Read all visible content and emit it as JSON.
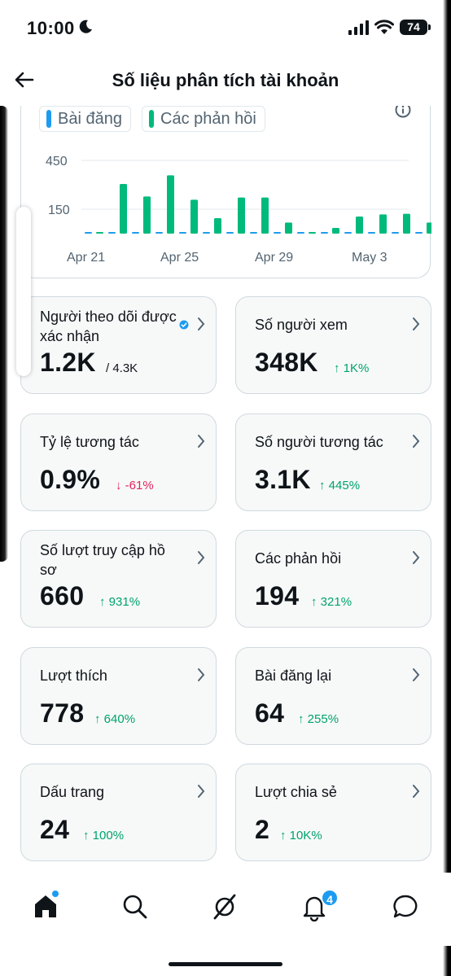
{
  "status_bar": {
    "time": "10:00",
    "battery": "74"
  },
  "header": {
    "title": "Số liệu phân tích tài khoản"
  },
  "chart": {
    "legend": [
      {
        "label": "Bài đăng",
        "color": "#1d9bf0"
      },
      {
        "label": "Các phản hồi",
        "color": "#00ba7c"
      }
    ],
    "y_ticks": [
      "450",
      "150"
    ],
    "x_ticks": [
      "Apr 21",
      "Apr 25",
      "Apr 29",
      "May 3"
    ]
  },
  "chart_data": {
    "type": "bar",
    "categories": [
      "Apr 21",
      "Apr 22",
      "Apr 23",
      "Apr 24",
      "Apr 25",
      "Apr 26",
      "Apr 27",
      "Apr 28",
      "Apr 29",
      "Apr 30",
      "May 1",
      "May 2",
      "May 3",
      "May 4",
      "May 5"
    ],
    "series": [
      {
        "name": "Bài đăng",
        "values": [
          5,
          0,
          0,
          10,
          0,
          0,
          0,
          0,
          0,
          0,
          0,
          0,
          0,
          0,
          0
        ]
      },
      {
        "name": "Các phản hồi",
        "values": [
          0,
          305,
          228,
          358,
          208,
          95,
          222,
          222,
          68,
          8,
          35,
          105,
          118,
          122,
          68
        ]
      }
    ],
    "ylim": [
      0,
      500
    ],
    "y_ticks": [
      150,
      450
    ]
  },
  "metrics": [
    {
      "label": "Người theo dõi được xác nhận",
      "value": "1.2K",
      "sub": "/ 4.3K",
      "verified": true
    },
    {
      "label": "Số người xem",
      "value": "348K",
      "change": "↑ 1K%",
      "direction": "up"
    },
    {
      "label": "Tỷ lệ tương tác",
      "value": "0.9%",
      "change": "↓ -61%",
      "direction": "down"
    },
    {
      "label": "Số người tương tác",
      "value": "3.1K",
      "change": "↑ 445%",
      "direction": "up"
    },
    {
      "label": "Số lượt truy cập hồ sơ",
      "value": "660",
      "change": "↑ 931%",
      "direction": "up"
    },
    {
      "label": "Các phản hồi",
      "value": "194",
      "change": "↑ 321%",
      "direction": "up"
    },
    {
      "label": "Lượt thích",
      "value": "778",
      "change": "↑ 640%",
      "direction": "up"
    },
    {
      "label": "Bài đăng lại",
      "value": "64",
      "change": "↑ 255%",
      "direction": "up"
    },
    {
      "label": "Dấu trang",
      "value": "24",
      "change": "↑ 100%",
      "direction": "up"
    },
    {
      "label": "Lượt chia sẻ",
      "value": "2",
      "change": "↑ 10K%",
      "direction": "up"
    }
  ],
  "nav": {
    "notifications_badge": "4"
  },
  "icons": [
    "back-arrow-icon",
    "info-icon",
    "chevron-right-icon",
    "verified-icon",
    "home-icon",
    "search-icon",
    "grok-icon",
    "bell-icon",
    "chat-icon"
  ]
}
